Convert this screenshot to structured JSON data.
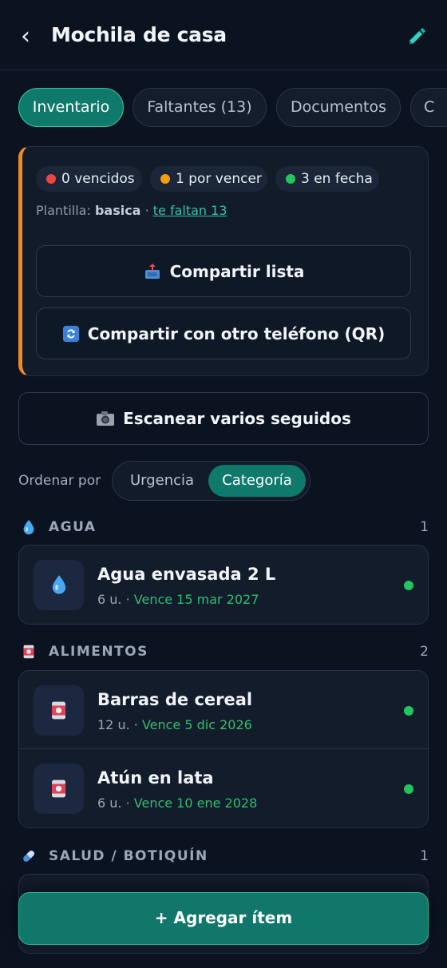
{
  "header": {
    "back_icon": "‹",
    "title": "Mochila de casa",
    "edit_icon": "pencil-icon"
  },
  "tabs": [
    {
      "label": "Inventario",
      "active": true
    },
    {
      "label": "Faltantes (13)",
      "active": false
    },
    {
      "label": "Documentos",
      "active": false
    },
    {
      "label": "C",
      "active": false
    }
  ],
  "summary": {
    "badges": [
      {
        "label": "0 vencidos",
        "color": "#ef4444"
      },
      {
        "label": "1 por vencer",
        "color": "#f59e0b"
      },
      {
        "label": "3 en fecha",
        "color": "#22c55e"
      }
    ],
    "template_prefix": "Plantilla:",
    "template_name": "basica",
    "separator": "·",
    "missing_link": "te faltan 13",
    "share_list_label": "Compartir lista",
    "share_qr_label": "Compartir con otro teléfono (QR)",
    "accent_color": "#f08a24"
  },
  "scan_label": "Escanear varios seguidos",
  "sort": {
    "label": "Ordenar por",
    "options": [
      "Urgencia",
      "Categoría"
    ],
    "selected": "Categoría"
  },
  "categories": [
    {
      "name": "AGUA",
      "count": "1",
      "icon": "water-drop-icon",
      "items": [
        {
          "name": "Agua envasada 2 L",
          "qty": "6 u.",
          "expiry": "Vence 15 mar 2027",
          "icon": "water-drop-icon"
        }
      ]
    },
    {
      "name": "ALIMENTOS",
      "count": "2",
      "icon": "canned-food-icon",
      "items": [
        {
          "name": "Barras de cereal",
          "qty": "12 u.",
          "expiry": "Vence 5 dic 2026",
          "icon": "canned-food-icon"
        },
        {
          "name": "Atún en lata",
          "qty": "6 u.",
          "expiry": "Vence 10 ene 2028",
          "icon": "canned-food-icon"
        }
      ]
    },
    {
      "name": "SALUD / BOTIQUÍN",
      "count": "1",
      "icon": "pill-icon",
      "items": []
    }
  ],
  "add_button": "+ Agregar ítem"
}
